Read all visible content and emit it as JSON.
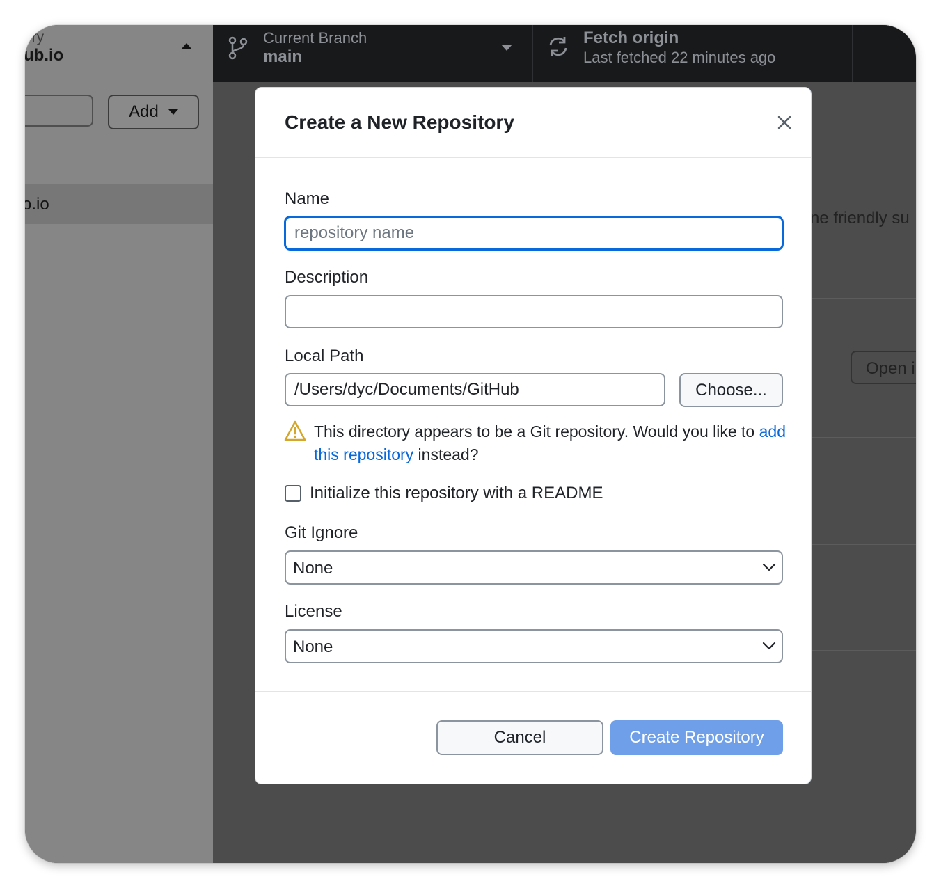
{
  "sidebar": {
    "repo_label_partial": "ory",
    "repo_name_partial": "ub.io",
    "add_button_label": "Add",
    "selected_repo_partial": "o.io"
  },
  "toolbar": {
    "branch_label": "Current Branch",
    "branch_name": "main",
    "fetch_label": "Fetch origin",
    "fetch_status": "Last fetched 22 minutes ago"
  },
  "background": {
    "partial_text": "ne friendly su",
    "open_button_partial": "Open i"
  },
  "dialog": {
    "title": "Create a New Repository",
    "name_label": "Name",
    "name_placeholder": "repository name",
    "name_value": "",
    "description_label": "Description",
    "description_value": "",
    "local_path_label": "Local Path",
    "local_path_value": "/Users/dyc/Documents/GitHub",
    "choose_button_label": "Choose...",
    "warning_text_before": "This directory appears to be a Git repository. Would you like to ",
    "warning_link_text": "add this repository",
    "warning_text_after": " instead?",
    "readme_checkbox_label": "Initialize this repository with a README",
    "readme_checked": false,
    "gitignore_label": "Git Ignore",
    "gitignore_selected": "None",
    "license_label": "License",
    "license_selected": "None",
    "cancel_button_label": "Cancel",
    "create_button_label": "Create Repository"
  },
  "colors": {
    "accent": "#0969da",
    "create_button_disabled": "#6e9fe8",
    "warning": "#d4a72c",
    "toolbar_bg": "#18191b"
  },
  "icons": {
    "branch": "git-branch-icon",
    "fetch": "sync-icon",
    "close": "close-icon",
    "warning": "warning-triangle-icon",
    "select_chevron": "chevron-down-icon",
    "repo_toggle": "caret-up-icon",
    "add_menu": "caret-down-icon"
  }
}
